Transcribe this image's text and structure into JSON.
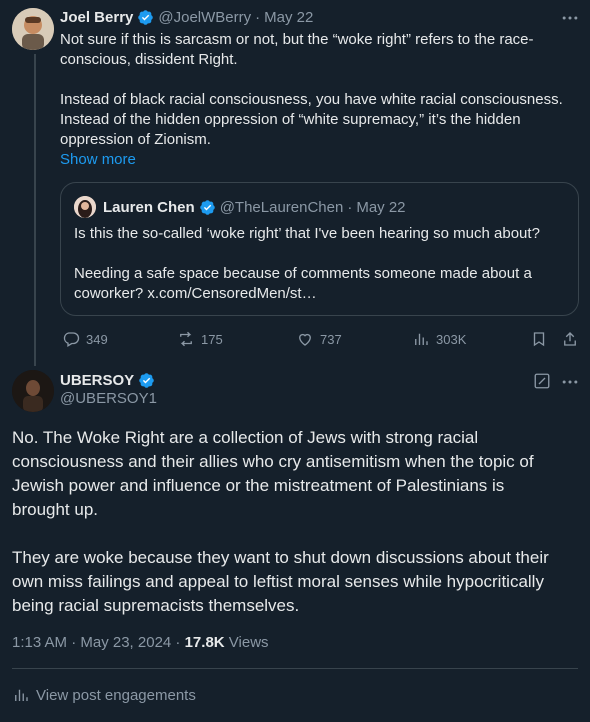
{
  "parent": {
    "name": "Joel Berry",
    "handle": "@JoelWBerry",
    "date": "May 22",
    "para1_line1": "Not sure if this is sarcasm or not, but the “woke right” refers to the race-",
    "para1_line2": "conscious, dissident Right.",
    "para2_line1": "Instead of black racial consciousness, you have white racial consciousness.",
    "para2_line2": "Instead of the hidden oppression of “white supremacy,” it’s the hidden",
    "para2_line3": "oppression of Zionism.",
    "show_more": "Show more",
    "quote": {
      "name": "Lauren Chen",
      "handle": "@TheLaurenChen",
      "date": "May 22",
      "line1": "Is this the so-called ‘woke right’ that I've been hearing so much about?",
      "line2": "Needing a safe space because of comments someone made about a",
      "line3": "coworker? x.com/CensoredMen/st…"
    },
    "actions": {
      "replies": "349",
      "reposts": "175",
      "likes": "737",
      "views": "303K"
    }
  },
  "reply": {
    "name": "UBERSOY",
    "handle": "@UBERSOY1",
    "p1_l1": "No. The Woke Right are a collection of Jews with strong racial",
    "p1_l2": "consciousness and their allies who cry antisemitism when the topic of",
    "p1_l3": "Jewish power and influence or the mistreatment of Palestinians is",
    "p1_l4": "brought up.",
    "p2_l1": "They are woke because they want to shut down discussions about their",
    "p2_l2": "own miss failings and appeal to leftist moral senses while hypocritically",
    "p2_l3": "being racial supremacists themselves.",
    "timestamp": "1:13 AM · May 23, 2024 · ",
    "views_count": "17.8K",
    "views_label": " Views",
    "engagements": "View post engagements"
  },
  "colors": {
    "background": "#15202b",
    "accent": "#1d9bf0",
    "muted": "#8b98a5",
    "border": "#38444d"
  },
  "icons": [
    "verified-badge-icon",
    "more-icon",
    "reply-icon",
    "repost-icon",
    "like-icon",
    "views-icon",
    "bookmark-icon",
    "share-icon",
    "edit-icon",
    "analytics-icon"
  ]
}
